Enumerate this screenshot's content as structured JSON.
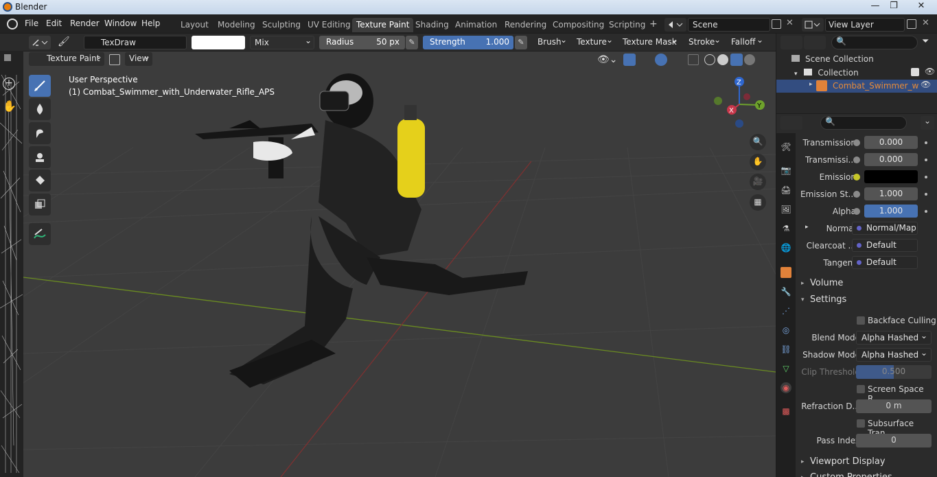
{
  "window": {
    "title": "Blender",
    "min": "—",
    "max": "❐",
    "close": "✕"
  },
  "menubar": {
    "items": [
      "File",
      "Edit",
      "Render",
      "Window",
      "Help"
    ],
    "workspaces": [
      "Layout",
      "Modeling",
      "Sculpting",
      "UV Editing",
      "Texture Paint",
      "Shading",
      "Animation",
      "Rendering",
      "Compositing",
      "Scripting"
    ],
    "active_workspace": "Texture Paint",
    "add_tab": "+",
    "scene": "Scene",
    "view_layer": "View Layer"
  },
  "tool_header": {
    "brush_name": "TexDraw",
    "blend": "Mix",
    "radius_label": "Radius",
    "radius_value": "50 px",
    "strength_label": "Strength",
    "strength_value": "1.000",
    "menus": [
      "Brush",
      "Texture",
      "Texture Mask",
      "Stroke",
      "Falloff"
    ]
  },
  "viewport_header": {
    "mode": "Texture Paint",
    "view": "View"
  },
  "viewport": {
    "perspective": "User Perspective",
    "object": "(1) Combat_Swimmer_with_Underwater_Rifle_APS",
    "gizmo": {
      "x": "X",
      "y": "Y",
      "z": "Z"
    }
  },
  "outliner": {
    "scene_collection": "Scene Collection",
    "collection": "Collection",
    "object": "Combat_Swimmer_w"
  },
  "properties": {
    "rows": [
      {
        "label": "Transmission",
        "value": "0.000"
      },
      {
        "label": "Transmissi...",
        "value": "0.000"
      },
      {
        "label": "Emission",
        "value": ""
      },
      {
        "label": "Emission St...",
        "value": "1.000"
      },
      {
        "label": "Alpha",
        "value": "1.000"
      }
    ],
    "links": [
      {
        "label": "Normal",
        "value": "Normal/Map"
      },
      {
        "label": "Clearcoat ...",
        "value": "Default"
      },
      {
        "label": "Tangent",
        "value": "Default"
      }
    ],
    "sections": {
      "volume": "Volume",
      "settings": "Settings",
      "viewport_display": "Viewport Display",
      "custom_props": "Custom Properties"
    },
    "settings": {
      "backface_culling": "Backface Culling",
      "blend_mode_label": "Blend Mode",
      "blend_mode": "Alpha Hashed",
      "shadow_mode_label": "Shadow Mode",
      "shadow_mode": "Alpha Hashed",
      "clip_threshold_label": "Clip Threshold",
      "clip_threshold": "0.500",
      "screen_space": "Screen Space R...",
      "refraction_label": "Refraction D...",
      "refraction": "0 m",
      "subsurface": "Subsurface Tran...",
      "pass_index_label": "Pass Index",
      "pass_index": "0"
    }
  },
  "colors": {
    "accent": "#4772b3",
    "viewport_bg": "#3c3c3c",
    "emission": "#000000",
    "grid_x": "#7d3131",
    "grid_y": "#6b8c21"
  }
}
